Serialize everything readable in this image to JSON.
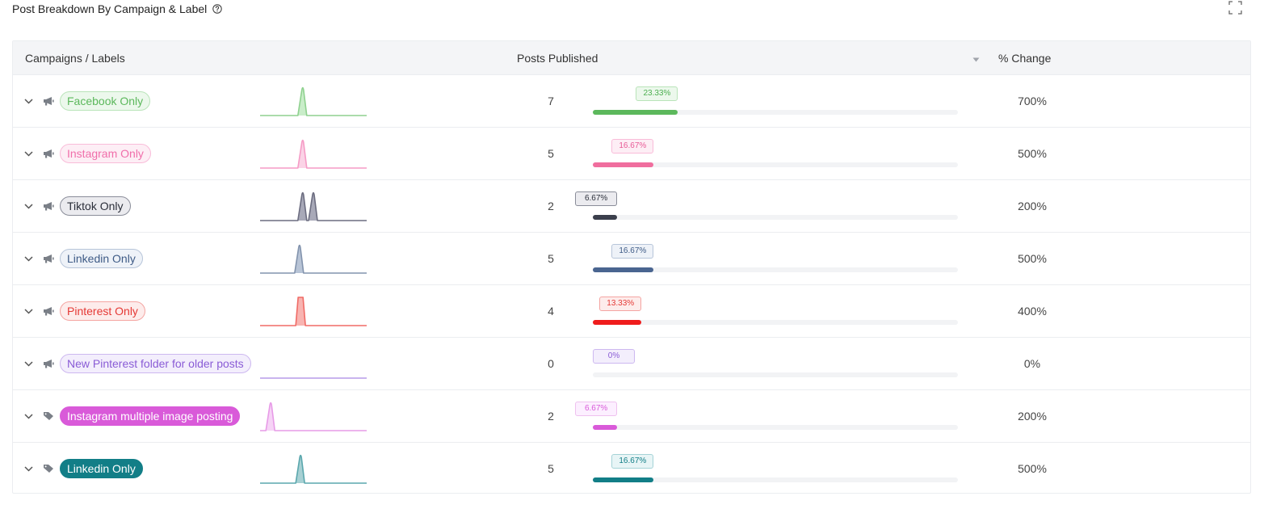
{
  "header": {
    "title": "Post Breakdown By Campaign & Label",
    "help_icon": "question-circle-icon",
    "expand_icon": "fullscreen-icon"
  },
  "table": {
    "columns": {
      "campaigns": "Campaigns / Labels",
      "posts": "Posts Published",
      "change": "% Change"
    },
    "sort_icon": "caret-down-icon",
    "rows": [
      {
        "name": "Facebook Only",
        "type": "campaign",
        "icon": "megaphone-icon",
        "posts": "7",
        "share": "23.33%",
        "share_value": 0.2333,
        "change": "700%",
        "pill_text": "#5cb85c",
        "pill_bg": "#ecf8ec",
        "pill_border": "#b9e4b9",
        "bar": "#5cb85c",
        "badge_text": "#4caf50",
        "badge_bg": "#ecf8ec",
        "badge_border": "#b9e4b9",
        "spark": "#8fd18f",
        "spark_fill": "#c9edc9",
        "peaks": [
          0.4
        ]
      },
      {
        "name": "Instagram Only",
        "type": "campaign",
        "icon": "megaphone-icon",
        "posts": "5",
        "share": "16.67%",
        "share_value": 0.1667,
        "change": "500%",
        "pill_text": "#f06eaa",
        "pill_bg": "#fdeef5",
        "pill_border": "#f9bcd9",
        "bar": "#f06e9e",
        "badge_text": "#e85a96",
        "badge_bg": "#fdeef5",
        "badge_border": "#f9bcd9",
        "spark": "#f59cc6",
        "spark_fill": "#fbd3e6",
        "peaks": [
          0.4
        ]
      },
      {
        "name": "Tiktok Only",
        "type": "campaign",
        "icon": "megaphone-icon",
        "posts": "2",
        "share": "6.67%",
        "share_value": 0.0667,
        "change": "200%",
        "pill_text": "#2b2f3a",
        "pill_bg": "#ebebef",
        "pill_border": "#8a8d99",
        "bar": "#3b3f4c",
        "badge_text": "#2b2f3a",
        "badge_bg": "#ebebef",
        "badge_border": "#8a8d99",
        "spark": "#6c6d80",
        "spark_fill": "#a8a9b8",
        "peaks": [
          0.4,
          0.5
        ]
      },
      {
        "name": "Linkedin Only",
        "type": "campaign",
        "icon": "megaphone-icon",
        "posts": "5",
        "share": "16.67%",
        "share_value": 0.1667,
        "change": "500%",
        "pill_text": "#3e5b86",
        "pill_bg": "#eef2f8",
        "pill_border": "#b7c5d9",
        "bar": "#4a6590",
        "badge_text": "#3e5b86",
        "badge_bg": "#eef2f8",
        "badge_border": "#b7c5d9",
        "spark": "#8293ad",
        "spark_fill": "#b8c4d6",
        "peaks": [
          0.37
        ]
      },
      {
        "name": "Pinterest Only",
        "type": "campaign",
        "icon": "megaphone-icon",
        "posts": "4",
        "share": "13.33%",
        "share_value": 0.1333,
        "change": "400%",
        "pill_text": "#e53935",
        "pill_bg": "#fdeceb",
        "pill_border": "#f4a5a2",
        "bar": "#ef1c1c",
        "badge_text": "#e53935",
        "badge_bg": "#fdeceb",
        "badge_border": "#f4a5a2",
        "spark": "#f06b66",
        "spark_fill": "#f8b4b1",
        "peaks": [
          0.38
        ],
        "flat_top": true
      },
      {
        "name": "New Pinterest folder for older posts",
        "type": "campaign",
        "icon": "megaphone-icon",
        "posts": "0",
        "share": "0%",
        "share_value": 0,
        "change": "0%",
        "pill_text": "#8a5cd6",
        "pill_bg": "#f3eefc",
        "pill_border": "#cdb8f0",
        "bar": "#b79be8",
        "badge_text": "#8a5cd6",
        "badge_bg": "#f3eefc",
        "badge_border": "#cdb8f0",
        "spark": "#b79be8",
        "spark_fill": "#e7ddf8",
        "peaks": []
      },
      {
        "name": "Instagram multiple image posting",
        "type": "label",
        "icon": "tag-icon",
        "posts": "2",
        "share": "6.67%",
        "share_value": 0.0667,
        "change": "200%",
        "pill_text": "#ffffff",
        "pill_bg": "#d95ad9",
        "pill_border": "#d95ad9",
        "bar": "#d95ad9",
        "badge_text": "#d95ad9",
        "badge_bg": "#fcefff",
        "badge_border": "#efc1ef",
        "spark": "#e79be7",
        "spark_fill": "#f6d3f6",
        "peaks": [
          0.1
        ]
      },
      {
        "name": "Linkedin Only",
        "type": "label",
        "icon": "tag-icon",
        "posts": "5",
        "share": "16.67%",
        "share_value": 0.1667,
        "change": "500%",
        "pill_text": "#ffffff",
        "pill_bg": "#127e87",
        "pill_border": "#127e87",
        "bar": "#127e87",
        "badge_text": "#127e87",
        "badge_bg": "#e8f5f6",
        "badge_border": "#a5d3d7",
        "spark": "#5aa7ad",
        "spark_fill": "#a7d0d3",
        "peaks": [
          0.38
        ]
      }
    ]
  }
}
